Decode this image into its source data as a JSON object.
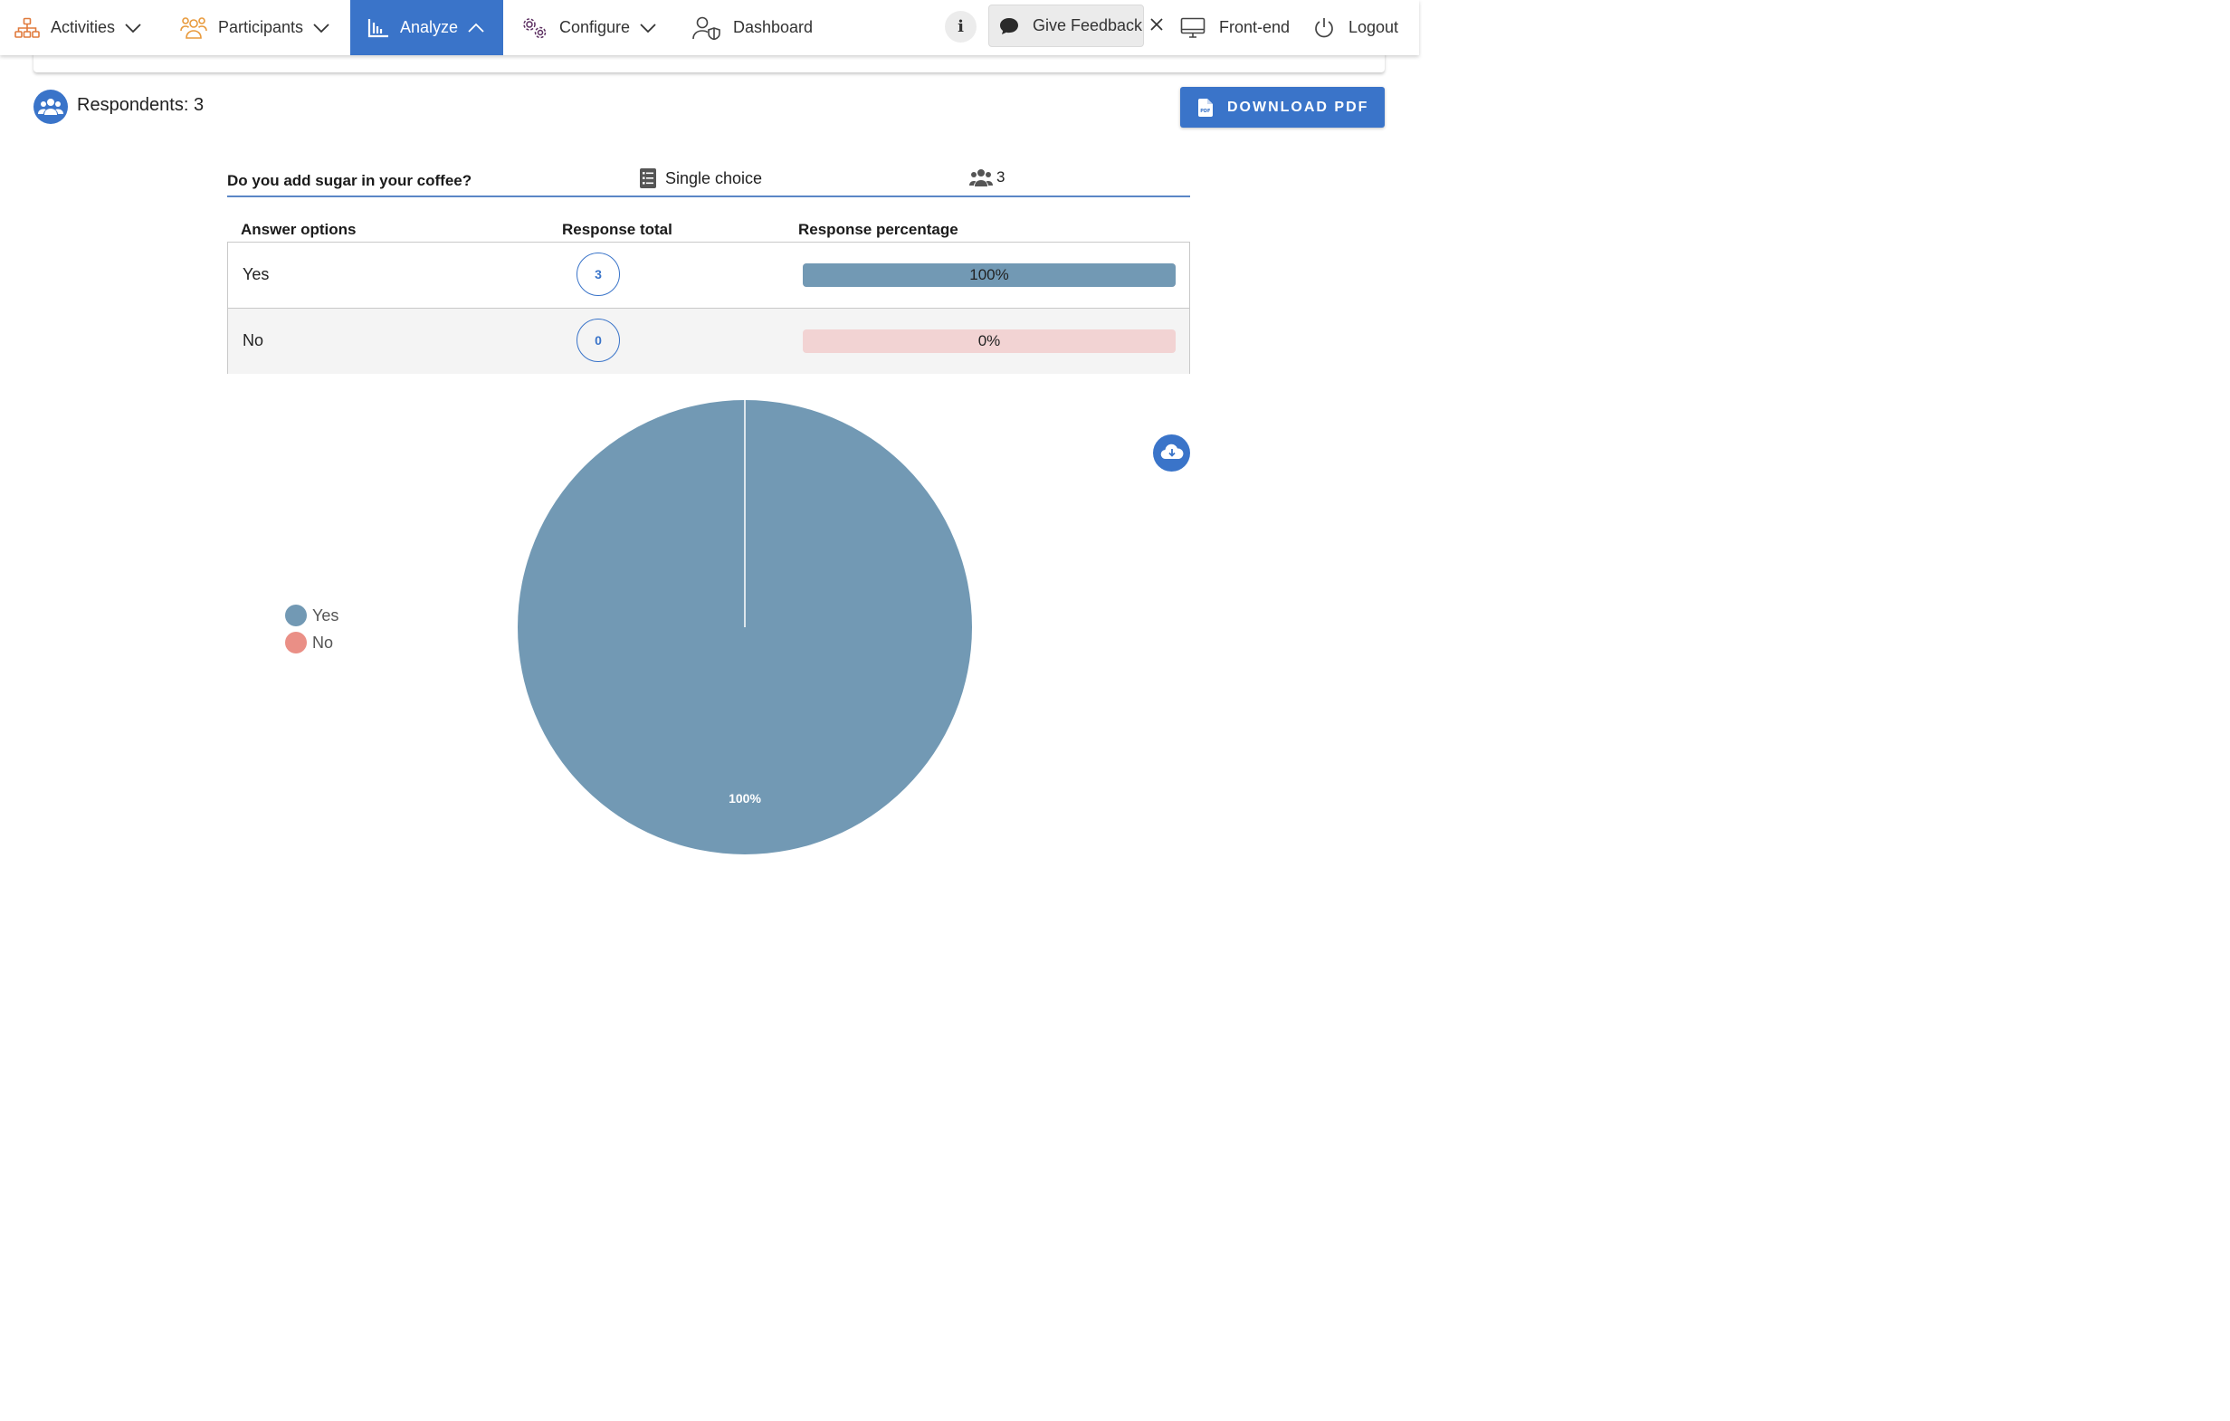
{
  "nav": {
    "activities": "Activities",
    "participants": "Participants",
    "analyze": "Analyze",
    "configure": "Configure",
    "dashboard": "Dashboard",
    "info": "i",
    "feedback": "Give Feedback",
    "frontend": "Front-end",
    "logout": "Logout"
  },
  "summary": {
    "respondents_label": "Respondents: 3",
    "download_pdf": "DOWNLOAD PDF"
  },
  "question": {
    "title": "Do you add sugar in your coffee?",
    "type": "Single choice",
    "respondent_count": "3"
  },
  "table": {
    "headers": [
      "Answer options",
      "Response total",
      "Response percentage"
    ],
    "rows": [
      {
        "option": "Yes",
        "total": "3",
        "percentage_label": "100%",
        "percentage": 100
      },
      {
        "option": "No",
        "total": "0",
        "percentage_label": "0%",
        "percentage": 0
      }
    ]
  },
  "colors": {
    "accent": "#3a74c9",
    "yes": "#7299b4",
    "no": "#ea8f86",
    "no_bar_bg": "#f2d3d3"
  },
  "chart_data": {
    "type": "pie",
    "categories": [
      "Yes",
      "No"
    ],
    "values": [
      3,
      0
    ],
    "data_labels": [
      "100%"
    ],
    "legend": [
      "Yes",
      "No"
    ],
    "legend_position": "left"
  }
}
